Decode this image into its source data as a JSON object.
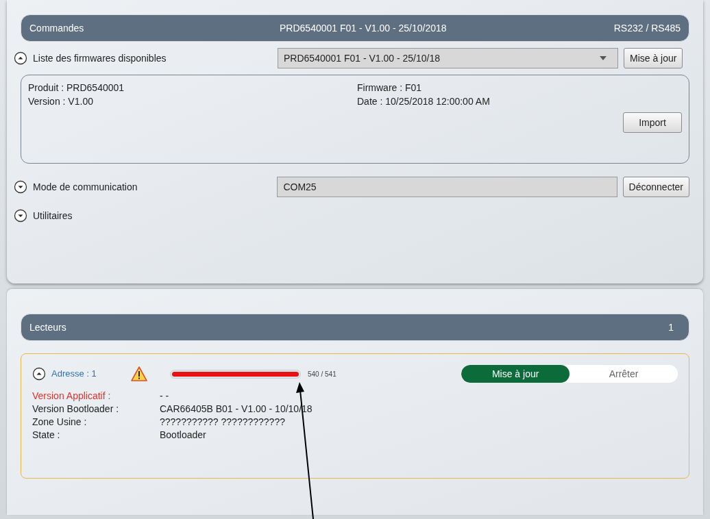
{
  "commands": {
    "title": "Commandes",
    "firmware": "PRD6540001 F01 - V1.00 - 25/10/2018",
    "interface": "RS232 / RS485",
    "sections": [
      {
        "label": "Liste des firmwares disponibles",
        "expanded": true,
        "kind": "select",
        "value": "PRD6540001 F01 - V1.00 - 25/10/18",
        "button": "Mise à jour"
      },
      {
        "label": "Mode de communication",
        "expanded": false,
        "kind": "field",
        "value": "COM25",
        "button": "Déconnecter"
      },
      {
        "label": "Utilitaires",
        "expanded": false,
        "kind": "plain"
      }
    ],
    "details": {
      "left": [
        "Produit : PRD6540001",
        "Version : V1.00"
      ],
      "right": [
        "Firmware : F01",
        "Date : 10/25/2018 12:00:00 AM"
      ],
      "button": "Import"
    }
  },
  "readers": {
    "title": "Lecteurs",
    "count": "1",
    "items": [
      {
        "address": "Adresse : 1",
        "expanded": true,
        "warning": true,
        "level": 0.998,
        "progress": "540 / 541",
        "actions": [
          {
            "label": "Mise à jour",
            "selected": true
          },
          {
            "label": "Arrêter",
            "selected": false
          }
        ],
        "rows": [
          {
            "label": "Version Applicatif :",
            "value": "- -",
            "alert": true
          },
          {
            "label": "Version Bootloader :",
            "value": "CAR66405B B01 - V1.00 - 10/10/18",
            "alert": false
          },
          {
            "label": "Zone Usine :",
            "value": "??????????? ????????????",
            "alert": false
          },
          {
            "label": "State :",
            "value": "Bootloader",
            "alert": false
          }
        ]
      }
    ]
  },
  "annotation": {
    "arrow": true
  }
}
